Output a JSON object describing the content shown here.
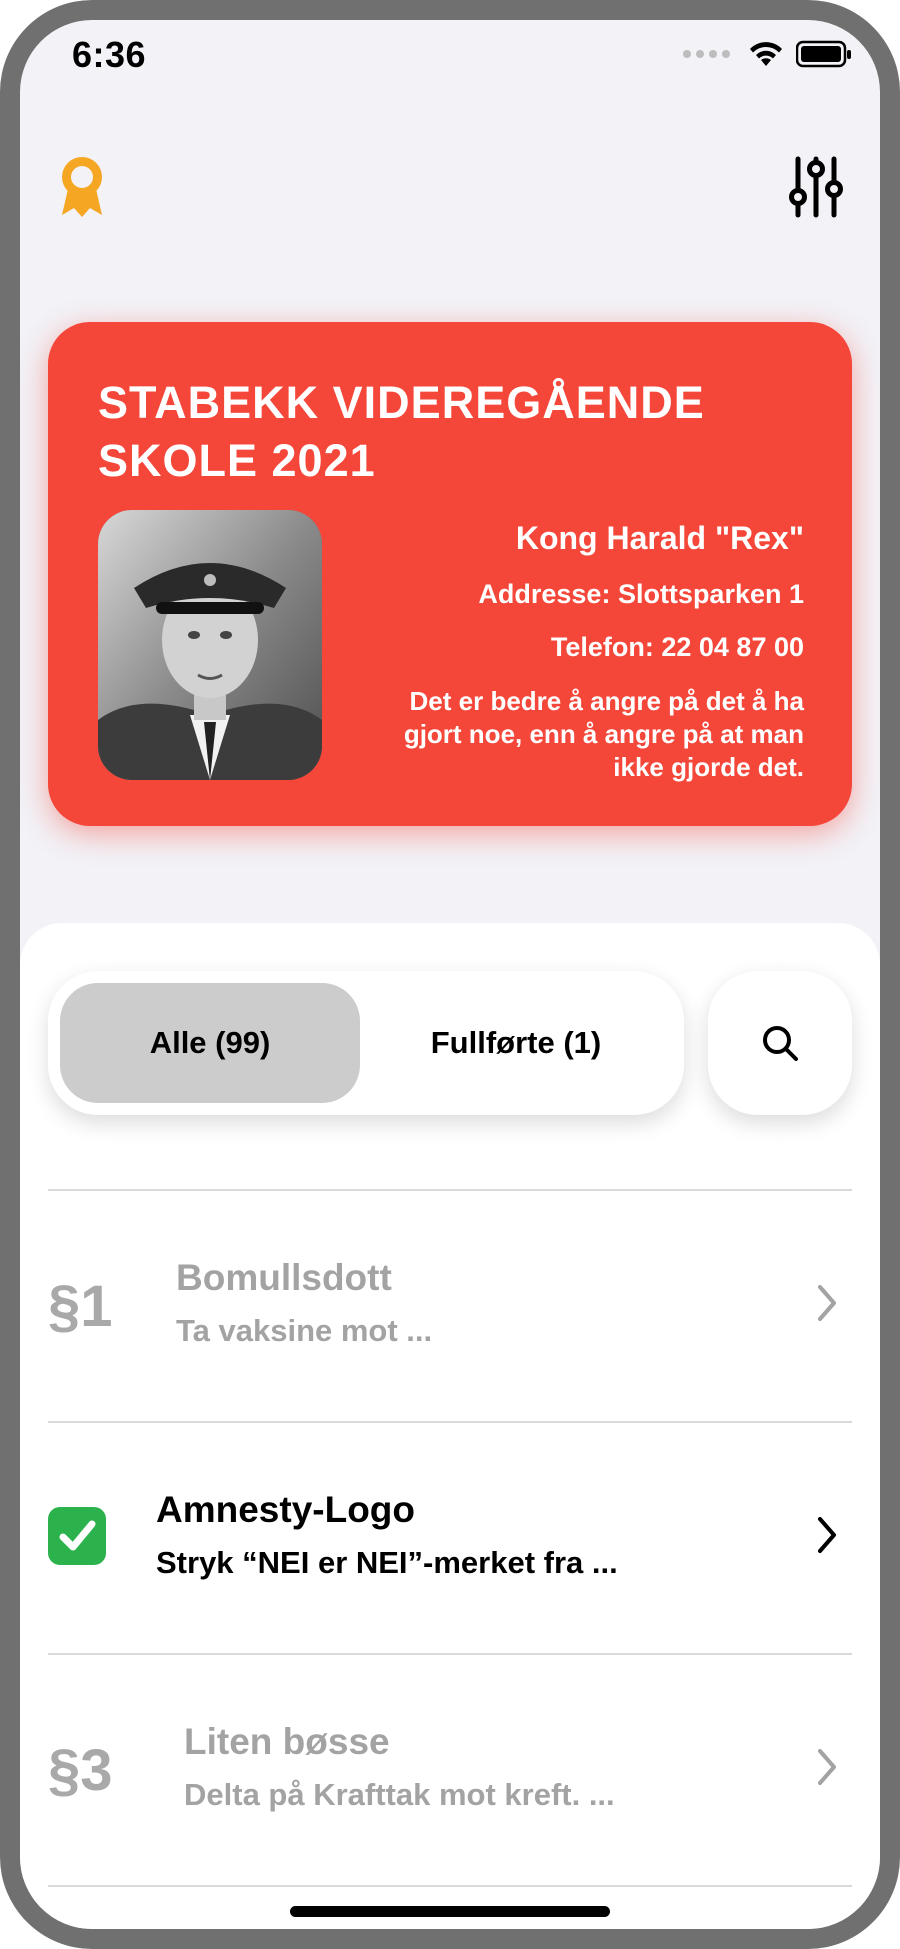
{
  "status_bar": {
    "time": "6:36"
  },
  "header": {
    "left_icon": "award-icon",
    "right_icon": "sliders-icon",
    "accent": "#f5a623"
  },
  "card": {
    "title": "STABEKK VIDEREGÅENDE SKOLE 2021",
    "name": "Kong Harald \"Rex\"",
    "address": "Addresse: Slottsparken 1",
    "phone": "Telefon: 22 04 87 00",
    "quote": "Det er bedre å angre på det å ha gjort noe, enn å angre på at man ikke gjorde det.",
    "color": "#f4473a"
  },
  "filters": {
    "all_label": "Alle (99)",
    "completed_label": "Fullførte (1)",
    "selected": "Alle (99)"
  },
  "items": [
    {
      "number": "§1",
      "title": "Bomullsdott",
      "subtitle": "Ta vaksine mot ...",
      "completed": false
    },
    {
      "number": "",
      "title": "Amnesty-Logo",
      "subtitle": "Stryk “NEI er NEI”-merket fra ...",
      "completed": true
    },
    {
      "number": "§3",
      "title": "Liten bøsse",
      "subtitle": "Delta på Krafttak mot kreft. ...",
      "completed": false
    }
  ]
}
